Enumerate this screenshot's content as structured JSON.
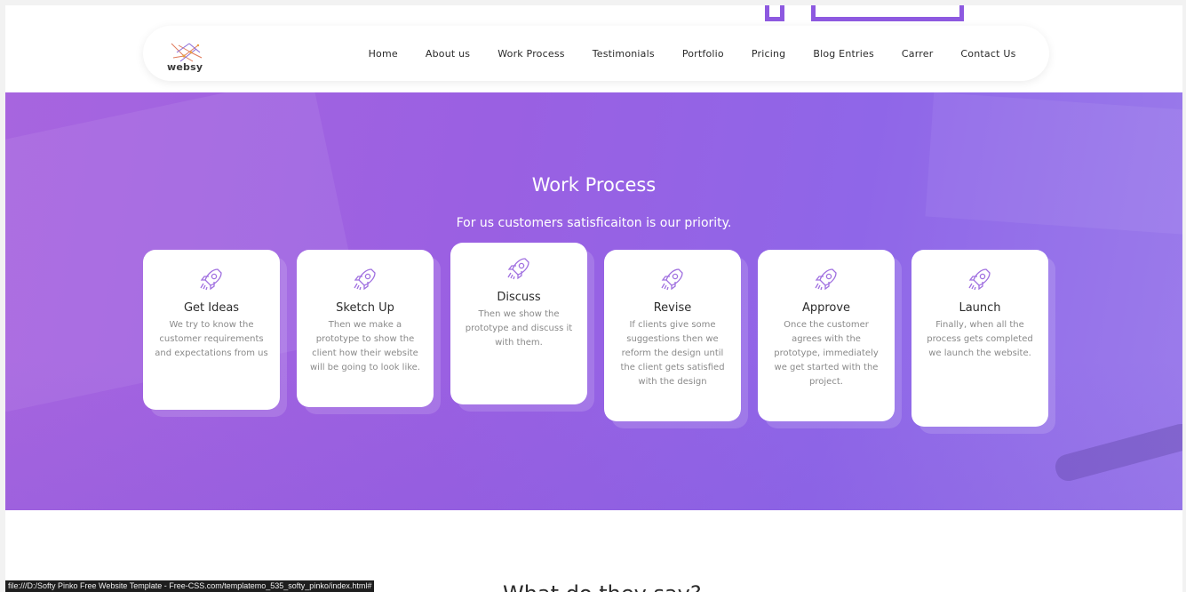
{
  "brand": {
    "logo_text": "websy"
  },
  "nav": {
    "items": [
      {
        "label": "Home"
      },
      {
        "label": "About us"
      },
      {
        "label": "Work Process"
      },
      {
        "label": "Testimonials"
      },
      {
        "label": "Portfolio"
      },
      {
        "label": "Pricing"
      },
      {
        "label": "Blog Entries"
      },
      {
        "label": "Carrer"
      },
      {
        "label": "Contact Us"
      }
    ]
  },
  "hero": {
    "title": "Work Process",
    "subtitle": "For us customers satisficaiton is our priority."
  },
  "cards": [
    {
      "icon": "rocket-icon",
      "title": "Get Ideas",
      "text": "We try to know the customer requirements and expectations from us"
    },
    {
      "icon": "rocket-icon",
      "title": "Sketch Up",
      "text": "Then we make a prototype to show the client how their website will be going to look like."
    },
    {
      "icon": "rocket-icon",
      "title": "Discuss",
      "text": "Then we show the prototype and discuss it with them."
    },
    {
      "icon": "rocket-icon",
      "title": "Revise",
      "text": "If clients give some suggestions then we reform the design until the client gets satisfied with the design"
    },
    {
      "icon": "rocket-icon",
      "title": "Approve",
      "text": "Once the customer agrees with the prototype, immediately we get started with the project."
    },
    {
      "icon": "rocket-icon",
      "title": "Launch",
      "text": "Finally, when all the process gets completed we launch the website."
    }
  ],
  "next_section": {
    "heading": "What do they say?"
  },
  "status_bar": {
    "url": "file:///D:/Softy Pinko Free Website Template - Free-CSS.com/templatemo_535_softy_pinko/index.html#"
  },
  "colors": {
    "accent": "#9a60e2",
    "card_bg": "#ffffff",
    "icon_stroke": "#a070e0"
  }
}
